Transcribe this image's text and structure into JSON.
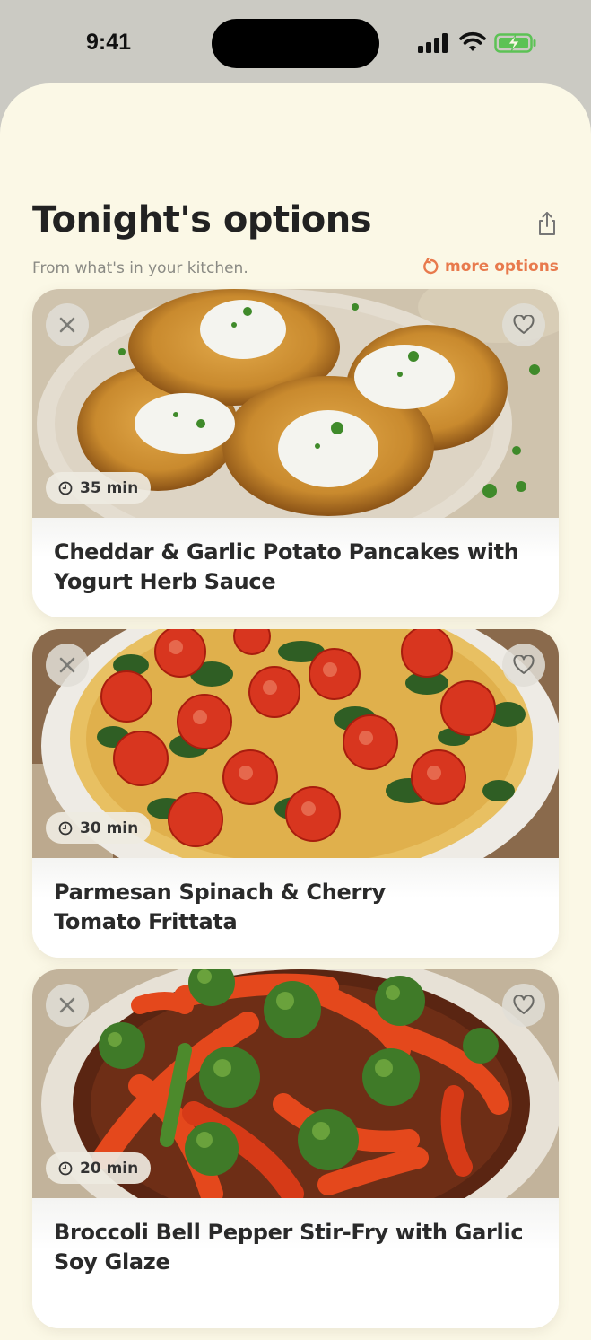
{
  "status_bar": {
    "time": "9:41"
  },
  "header": {
    "title": "Tonight's options",
    "subtitle": "From what's in your kitchen.",
    "more_options_label": "more options"
  },
  "colors": {
    "accent": "#e87a4d",
    "background": "#fbf8e6"
  },
  "recipes": [
    {
      "title": "Cheddar & Garlic Potato Pancakes with Yogurt Herb Sauce",
      "time": "35 min"
    },
    {
      "title": "Parmesan Spinach & Cherry Tomato Frittata",
      "time": "30 min"
    },
    {
      "title": "Broccoli Bell Pepper Stir-Fry with Garlic Soy Glaze",
      "time": "20 min"
    }
  ]
}
